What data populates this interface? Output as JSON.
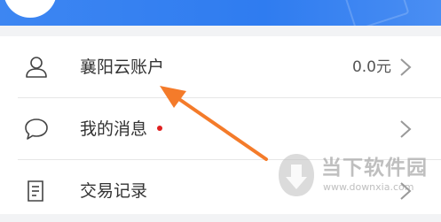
{
  "menu": {
    "items": [
      {
        "label": "襄阳云账户",
        "value": "0.0元",
        "icon": "user-icon",
        "has_chevron": true
      },
      {
        "label": "我的消息",
        "value": "",
        "icon": "chat-bubble-icon",
        "unread_dot": true,
        "has_chevron": true
      },
      {
        "label": "交易记录",
        "value": "",
        "icon": "document-icon",
        "has_chevron": true
      }
    ]
  },
  "annotation": {
    "type": "arrow",
    "color": "#f47b2a"
  },
  "watermark": {
    "brand": "当下软件园",
    "url": "www.downxia.com"
  },
  "colors": {
    "header_blue": "#2f7cf0",
    "unread_dot": "#e02020",
    "text": "#333333",
    "chevron": "#999999"
  }
}
